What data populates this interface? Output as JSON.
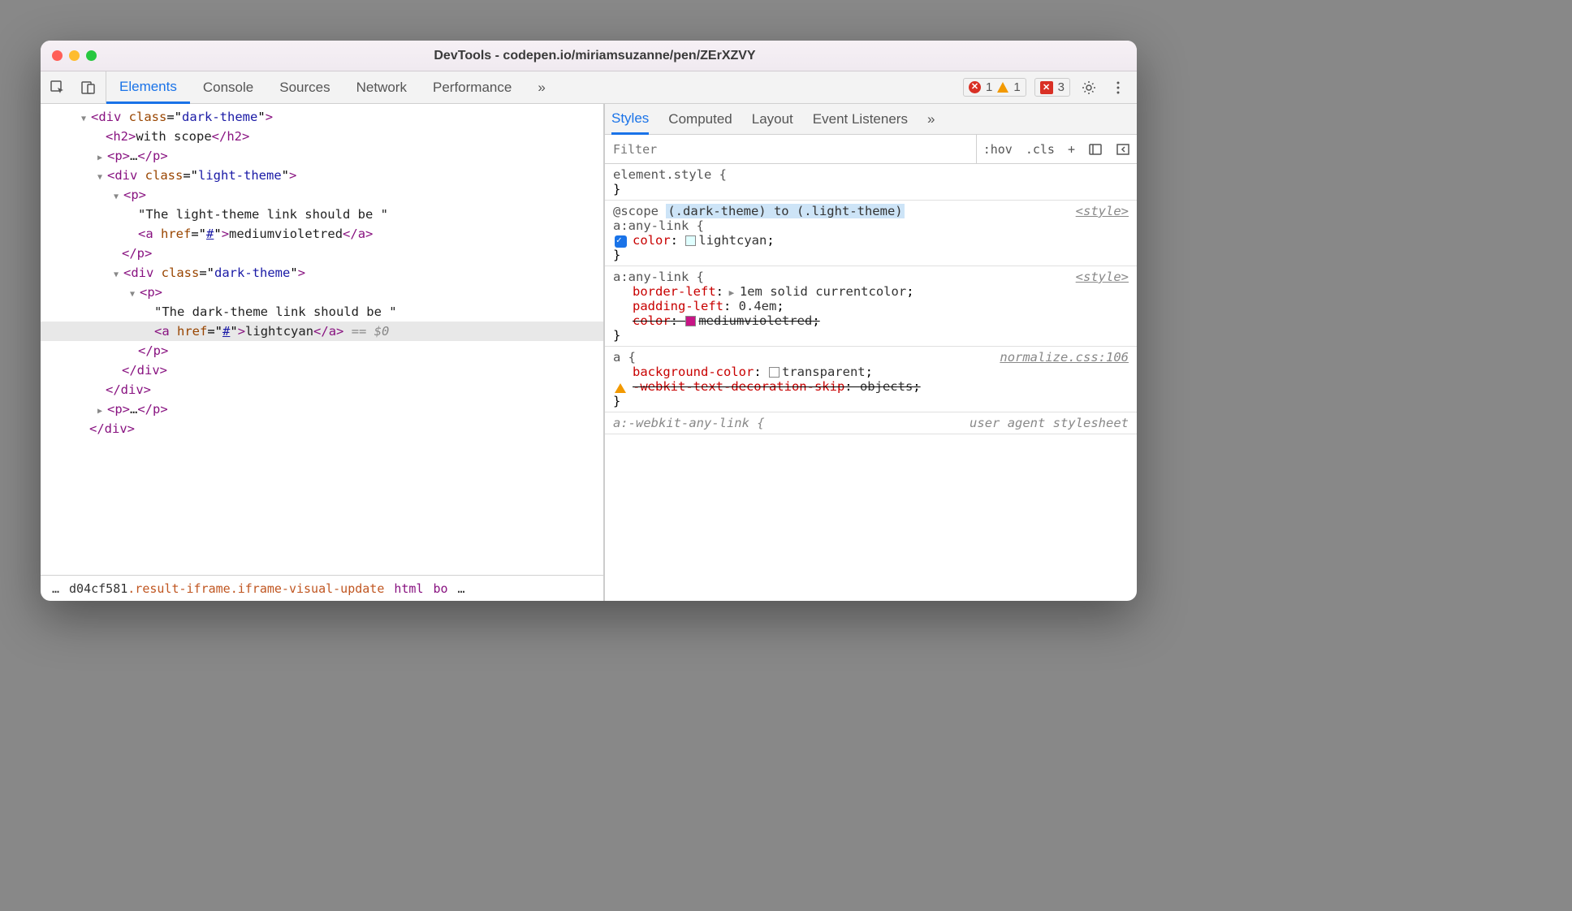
{
  "window": {
    "title": "DevTools - codepen.io/miriamsuzanne/pen/ZErXZVY"
  },
  "mainTabs": [
    "Elements",
    "Console",
    "Sources",
    "Network",
    "Performance"
  ],
  "counters": {
    "errors": "1",
    "warnings": "1",
    "issues": "3"
  },
  "dom": {
    "l1_open": "<div class=\"dark-theme\">",
    "l2_h2_open": "<h2>",
    "l2_h2_text": "with scope",
    "l2_h2_close": "</h2>",
    "l3_p_open": "<p>",
    "l3_p_ell": "…",
    "l3_p_close": "</p>",
    "l4_open": "<div class=\"light-theme\">",
    "l5_p_open": "<p>",
    "l6_text": "\"The light-theme link should be \"",
    "l7_a_open": "<a href=\"#\">",
    "l7_a_text": "mediumvioletred",
    "l7_a_close": "</a>",
    "l8_close": "</p>",
    "l9_open": "<div class=\"dark-theme\">",
    "l10_p_open": "<p>",
    "l11_text": "\"The dark-theme link should be \"",
    "l12_a_open": "<a href=\"#\">",
    "l12_a_text": "lightcyan",
    "l12_a_close": "</a>",
    "l12_var": " == $0",
    "l13_close": "</p>",
    "l14_close": "</div>",
    "l15_close": "</div>",
    "l16_p_open": "<p>",
    "l16_p_ell": "…",
    "l16_p_close": "</p>",
    "l17_close": "</div>"
  },
  "breadcrumb": {
    "pre": "…",
    "frag": "d04cf581",
    "cls": ".result-iframe.iframe-visual-update",
    "html": "html",
    "bo": "bo",
    "post": "…"
  },
  "subTabs": [
    "Styles",
    "Computed",
    "Layout",
    "Event Listeners"
  ],
  "filter": {
    "placeholder": "Filter",
    "hov": ":hov",
    "cls": ".cls",
    "plus": "+"
  },
  "styles": {
    "elementStyle": "element.style {",
    "closeBrace": "}",
    "rule1": {
      "scope": "@scope ",
      "scopeRange": "(.dark-theme) to (.light-theme)",
      "selector": "a:any-link {",
      "src": "<style>",
      "prop1_name": "color",
      "prop1_val": "lightcyan",
      "prop1_swatch": "#e0ffff"
    },
    "rule2": {
      "selector": "a:any-link {",
      "src": "<style>",
      "p1_name": "border-left",
      "p1_val": "1em solid currentcolor",
      "p2_name": "padding-left",
      "p2_val": "0.4em",
      "p3_name": "color",
      "p3_val": "mediumvioletred",
      "p3_swatch": "#c71585"
    },
    "rule3": {
      "selector": "a {",
      "src": "normalize.css:106",
      "p1_name": "background-color",
      "p1_val": "transparent",
      "p1_swatch": "#ffffff",
      "p2_name": "-webkit-text-decoration-skip",
      "p2_val": "objects"
    },
    "rule4": {
      "selector": "a:-webkit-any-link {",
      "src": "user agent stylesheet"
    }
  }
}
